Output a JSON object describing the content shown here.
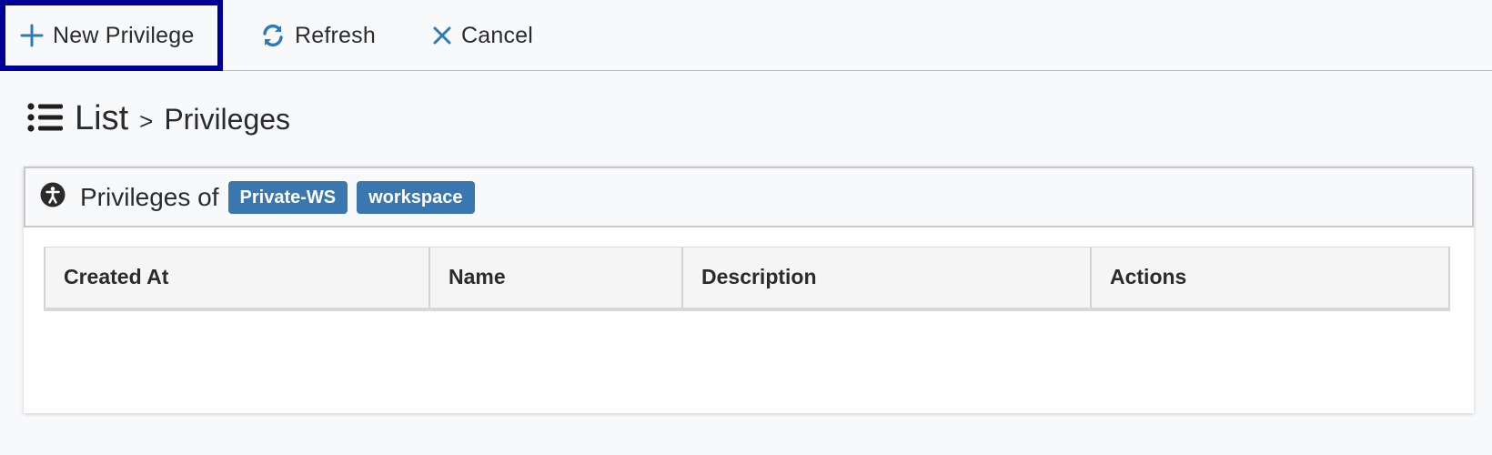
{
  "toolbar": {
    "new_label": "New Privilege",
    "refresh_label": "Refresh",
    "cancel_label": "Cancel"
  },
  "heading": {
    "section": "List",
    "separator": ">",
    "page": "Privileges"
  },
  "panel": {
    "title": "Privileges of",
    "tags": [
      "Private-WS",
      "workspace"
    ]
  },
  "table": {
    "columns": [
      "Created At",
      "Name",
      "Description",
      "Actions"
    ],
    "rows": []
  },
  "colors": {
    "accent": "#3a77b0",
    "focus_outline": "#000099",
    "icon_blue": "#2e7ab8"
  },
  "icons": {
    "new": "plus-icon",
    "refresh": "refresh-icon",
    "cancel": "close-icon",
    "list": "list-icon",
    "panel": "accessibility-icon"
  }
}
